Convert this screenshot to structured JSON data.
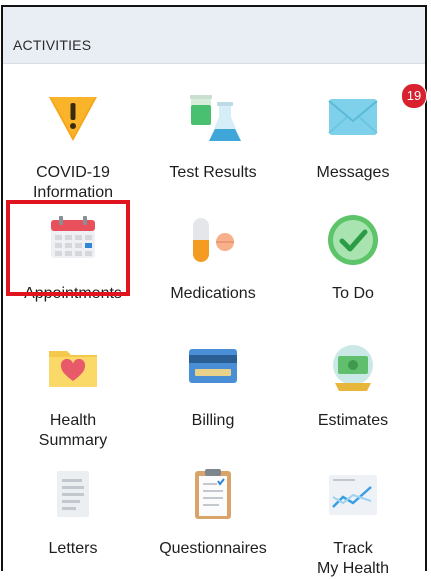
{
  "header": {
    "title": "ACTIVITIES"
  },
  "tiles": [
    {
      "label": "COVID-19\nInformation",
      "icon": "warning-icon"
    },
    {
      "label": "Test Results",
      "icon": "lab-flask-icon"
    },
    {
      "label": "Messages",
      "icon": "envelope-icon",
      "badge": "19"
    },
    {
      "label": "Appointments",
      "icon": "calendar-icon"
    },
    {
      "label": "Medications",
      "icon": "pill-icon"
    },
    {
      "label": "To Do",
      "icon": "checkmark-icon"
    },
    {
      "label": "Health\nSummary",
      "icon": "folder-heart-icon"
    },
    {
      "label": "Billing",
      "icon": "credit-card-icon"
    },
    {
      "label": "Estimates",
      "icon": "money-estimate-icon"
    },
    {
      "label": "Letters",
      "icon": "letter-document-icon"
    },
    {
      "label": "Questionnaires",
      "icon": "clipboard-icon"
    },
    {
      "label": "Track\nMy Health",
      "icon": "trend-chart-icon"
    }
  ],
  "colors": {
    "header_bg": "#e8eef4",
    "highlight": "#e0141e",
    "badge": "#d8202f",
    "accent": "#1a6fa8"
  }
}
